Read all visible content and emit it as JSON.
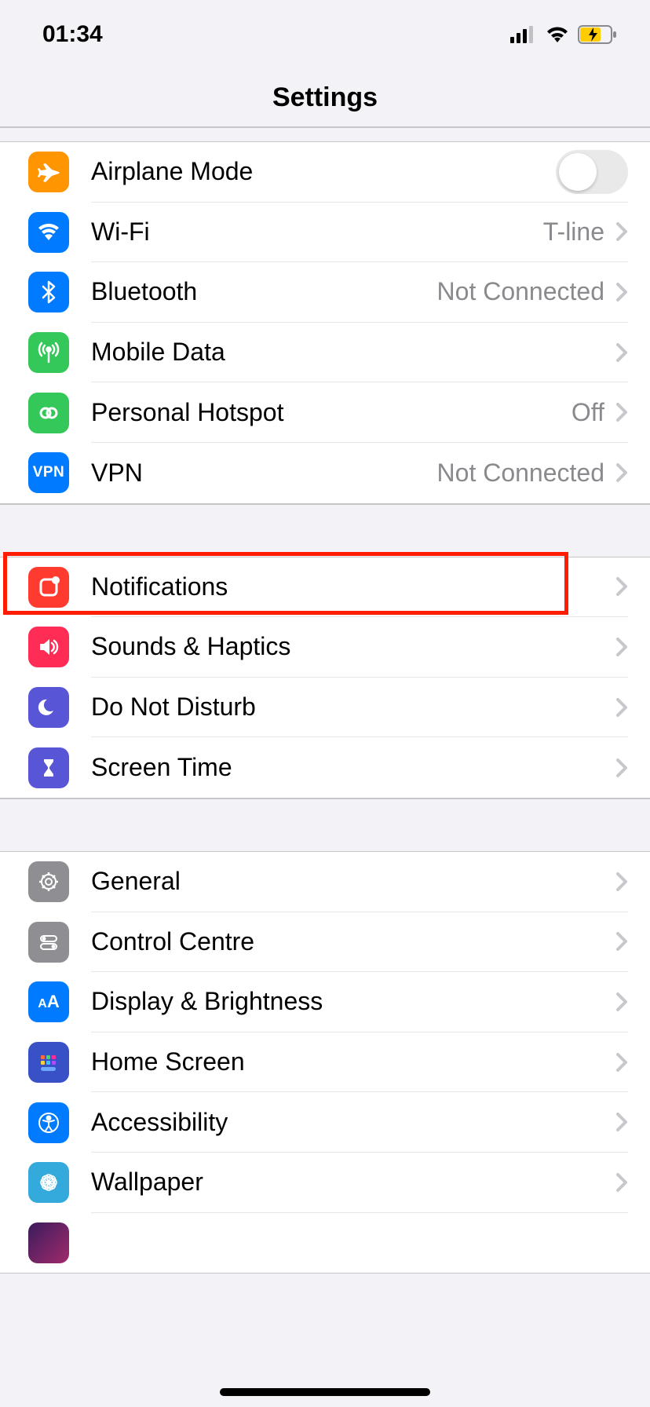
{
  "status": {
    "time": "01:34"
  },
  "header": {
    "title": "Settings"
  },
  "groups": [
    {
      "rows": [
        {
          "label": "Airplane Mode",
          "value": "",
          "type": "toggle"
        },
        {
          "label": "Wi-Fi",
          "value": "T-line",
          "type": "link"
        },
        {
          "label": "Bluetooth",
          "value": "Not Connected",
          "type": "link"
        },
        {
          "label": "Mobile Data",
          "value": "",
          "type": "link"
        },
        {
          "label": "Personal Hotspot",
          "value": "Off",
          "type": "link"
        },
        {
          "label": "VPN",
          "value": "Not Connected",
          "type": "link"
        }
      ]
    },
    {
      "rows": [
        {
          "label": "Notifications",
          "value": "",
          "type": "link"
        },
        {
          "label": "Sounds & Haptics",
          "value": "",
          "type": "link"
        },
        {
          "label": "Do Not Disturb",
          "value": "",
          "type": "link"
        },
        {
          "label": "Screen Time",
          "value": "",
          "type": "link"
        }
      ]
    },
    {
      "rows": [
        {
          "label": "General",
          "value": "",
          "type": "link"
        },
        {
          "label": "Control Centre",
          "value": "",
          "type": "link"
        },
        {
          "label": "Display & Brightness",
          "value": "",
          "type": "link"
        },
        {
          "label": "Home Screen",
          "value": "",
          "type": "link"
        },
        {
          "label": "Accessibility",
          "value": "",
          "type": "link"
        },
        {
          "label": "Wallpaper",
          "value": "",
          "type": "link"
        }
      ]
    }
  ]
}
